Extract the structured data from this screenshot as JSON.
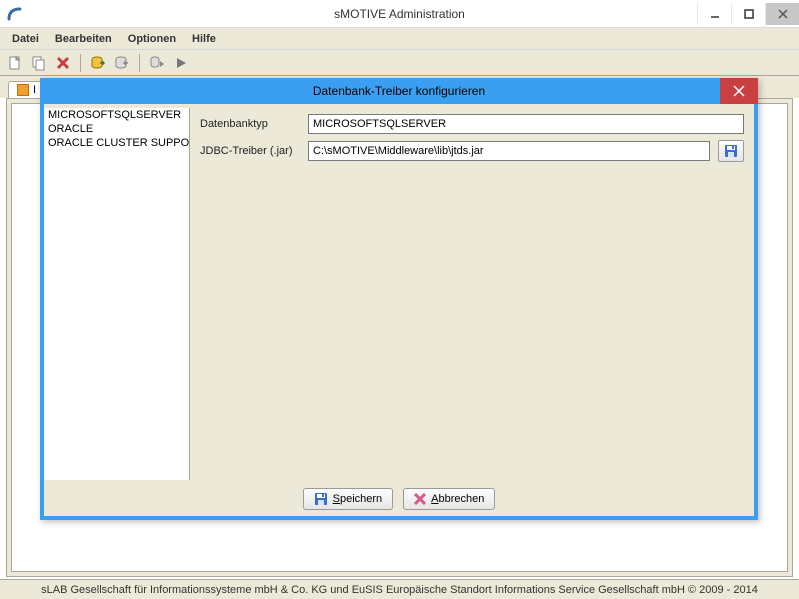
{
  "window": {
    "title": "sMOTIVE Administration"
  },
  "menu": {
    "file": "Datei",
    "edit": "Bearbeiten",
    "options": "Optionen",
    "help": "Hilfe"
  },
  "tab": {
    "label": "I"
  },
  "dialog": {
    "title": "Datenbank-Treiber konfigurieren",
    "list": {
      "items": [
        "MICROSOFTSQLSERVER",
        "ORACLE",
        "ORACLE CLUSTER SUPPORT"
      ],
      "selected": 0
    },
    "form": {
      "dbtype_label": "Datenbanktyp",
      "dbtype_value": "MICROSOFTSQLSERVER",
      "jdbc_label": "JDBC-Treiber (.jar)",
      "jdbc_value": "C:\\sMOTIVE\\Middleware\\lib\\jtds.jar"
    },
    "buttons": {
      "save": "Speichern",
      "cancel": "Abbrechen"
    }
  },
  "statusbar": {
    "text": "sLAB Gesellschaft für Informationssysteme mbH & Co. KG und EuSIS Europäische Standort Informations Service Gesellschaft mbH © 2009 - 2014"
  }
}
